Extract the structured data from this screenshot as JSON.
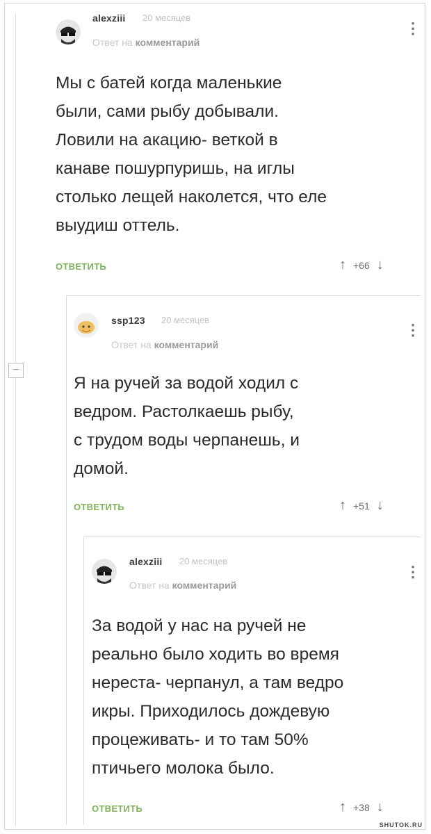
{
  "comments": [
    {
      "username": "alexziii",
      "time": "20 месяцев",
      "reply_prefix": "Ответ на",
      "reply_target": "комментарий",
      "text": "Мы с батей когда маленькие\nбыли, сами рыбу добывали.\nЛовили на акацию- веткой в\nканаве пошурпуришь, на иглы\nстолько лещей наколется, что еле\nвыудиш оттель.",
      "reply_label": "ОТВЕТИТЬ",
      "up": "↑",
      "score": "+66",
      "down": "↓",
      "menu": "⋮"
    },
    {
      "username": "ssp123",
      "time": "20 месяцев",
      "reply_prefix": "Ответ на",
      "reply_target": "комментарий",
      "text": "Я на ручей за водой ходил с\nведром. Растолкаешь рыбу,\nс трудом воды черпанешь, и\nдомой.",
      "reply_label": "ОТВЕТИТЬ",
      "up": "↑",
      "score": "+51",
      "down": "↓",
      "menu": "⋮"
    },
    {
      "username": "alexziii",
      "time": "20 месяцев",
      "reply_prefix": "Ответ на",
      "reply_target": "комментарий",
      "text": "За водой у нас на ручей не\nреально было ходить во время\nнереста- черпанул, а там ведро\nикры. Приходилось дождевую\nпроцеживать- и то там 50%\nптичьего молока было.",
      "reply_label": "ОТВЕТИТЬ",
      "up": "↑",
      "score": "+38",
      "down": "↓",
      "menu": "⋮"
    }
  ],
  "collapse_symbol": "−",
  "watermark": "SHUTOK.RU"
}
